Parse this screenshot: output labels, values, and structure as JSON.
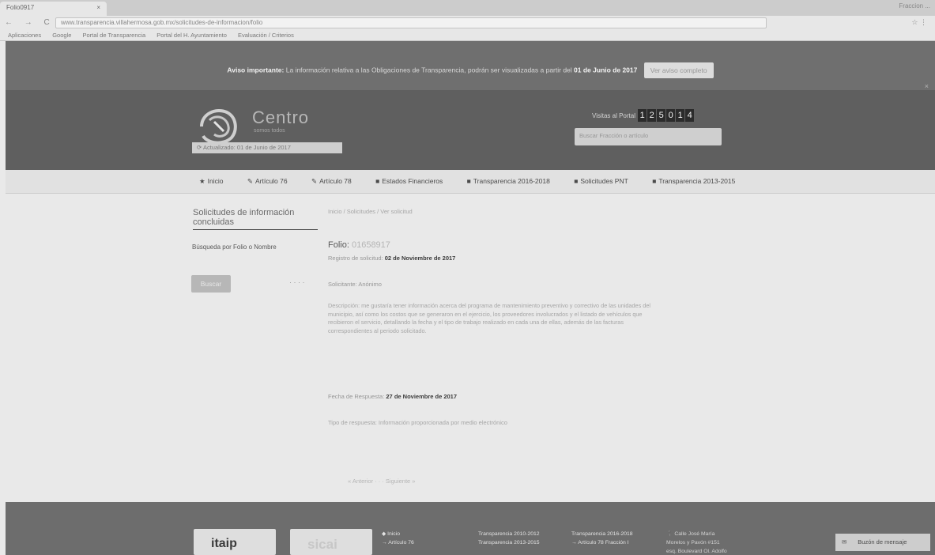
{
  "browser": {
    "tab_title": "Folio0917",
    "tab_close": "×",
    "top_right": "Fraccion ...",
    "url": "www.transparencia.villahermosa.gob.mx/solicitudes-de-informacion/folio",
    "nav_glyphs": "← → C ⌂",
    "menu_glyph": "☆ ⋮",
    "bookmarks": [
      "Aplicaciones",
      "Google",
      "Portal de Transparencia",
      "Portal del H. Ayuntamiento",
      "Evaluación / Criterios"
    ]
  },
  "notice": {
    "prefix": "Aviso importante:",
    "text": "La información relativa a las Obligaciones de Transparencia, podrán ser visualizadas a partir del",
    "date": "01 de Junio de 2017",
    "button": "Ver aviso completo",
    "close": "×"
  },
  "header": {
    "logo_word": "Centro",
    "logo_sub": "somos todos",
    "updated": "⟳ Actualizado: 01 de Junio de 2017",
    "visits_label": "Visitas al Portal",
    "visit_digits": [
      "1",
      "2",
      "5",
      "0",
      "1",
      "4"
    ],
    "search_placeholder": "Buscar Fracción o artículo"
  },
  "nav": {
    "items": [
      {
        "icon": "★",
        "label": "Inicio"
      },
      {
        "icon": "✎",
        "label": "Artículo 76"
      },
      {
        "icon": "✎",
        "label": "Artículo 78"
      },
      {
        "icon": "■",
        "label": "Estados Financieros"
      },
      {
        "icon": "■",
        "label": "Transparencia 2016-2018"
      },
      {
        "icon": "■",
        "label": "Solicitudes PNT"
      },
      {
        "icon": "■",
        "label": "Transparencia 2013-2015"
      }
    ]
  },
  "sidebar": {
    "title": "Solicitudes de información concluidas",
    "search_label": "Búsqueda por Folio o Nombre",
    "button": "Buscar",
    "dots": "· · · ·"
  },
  "detail": {
    "breadcrumb": "Inicio / Solicitudes / Ver solicitud",
    "folio_label": "Folio:",
    "folio_value": "01658917",
    "reg_label": "Registro de solicitud:",
    "reg_date": "02 de Noviembre de 2017",
    "solicitante": "Solicitante: Anónimo",
    "description": "Descripción: me gustaría tener información acerca del programa de mantenimiento preventivo y correctivo de las unidades del municipio, así como los costos que se generaron en el ejercicio, los proveedores involucrados y el listado de vehículos que recibieron el servicio, detallando la fecha y el tipo de trabajo realizado en cada una de ellas, además de las facturas correspondientes al periodo solicitado.",
    "resp_label": "Fecha de Respuesta:",
    "resp_date": "27 de Noviembre de 2017",
    "resp_type": "Tipo de respuesta: Información proporcionada por medio electrónico",
    "pager": "« Anterior · · · Siguiente »"
  },
  "footer": {
    "logo1": "itaip",
    "logo2": "sicai",
    "col1": [
      "◆ Inicio",
      "→ Artículo 76"
    ],
    "col2": [
      "Transparencia 2010-2012",
      "Transparencia 2013-2015"
    ],
    "col3": [
      "Transparencia 2016-2018",
      "→ Artículo 78 Fracción I"
    ],
    "col4": [
      "📍 Calle José María",
      "Morelos y Pavón #151",
      "esq. Boulevard Ol. Adolfo"
    ],
    "mailbox": "Buzón de mensaje",
    "mailbox_icon": "✉"
  }
}
